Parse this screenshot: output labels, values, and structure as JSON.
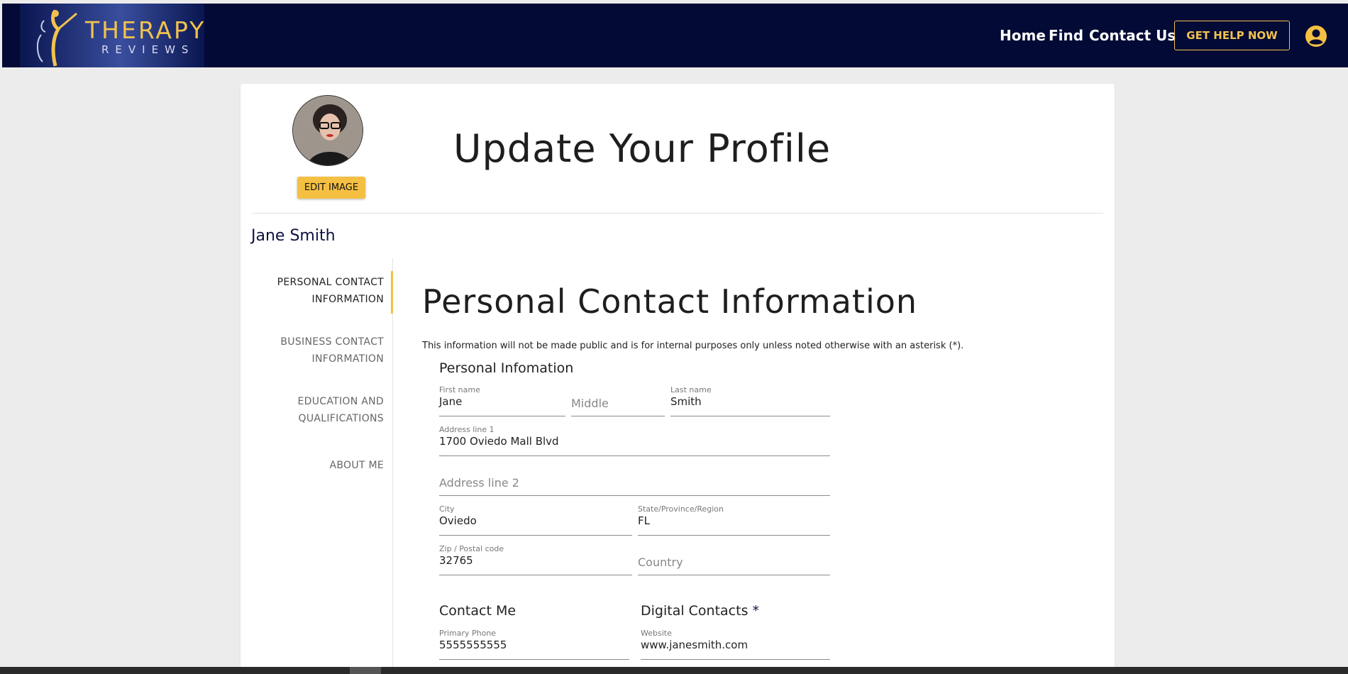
{
  "brand": {
    "name": "THERAPY",
    "sub": "REVIEWS"
  },
  "nav": {
    "home": "Home",
    "find": "Find",
    "contact": "Contact Us",
    "help": "GET HELP NOW"
  },
  "profile": {
    "title": "Update Your Profile",
    "edit_image": "EDIT IMAGE",
    "user_name": "Jane Smith"
  },
  "sidebar": {
    "items": [
      {
        "line1": "PERSONAL CONTACT",
        "line2": "INFORMATION"
      },
      {
        "line1": "BUSINESS CONTACT",
        "line2": "INFORMATION"
      },
      {
        "line1": "EDUCATION AND",
        "line2": "QUALIFICATIONS"
      },
      {
        "line1": "ABOUT ME",
        "line2": ""
      }
    ]
  },
  "section": {
    "title": "Personal Contact Information",
    "note": "This information will not be made public and is for internal purposes only unless noted otherwise with an asterisk (*)."
  },
  "personal": {
    "heading": "Personal Infomation",
    "first_label": "First name",
    "first_value": "Jane",
    "middle_placeholder": "Middle",
    "last_label": "Last name",
    "last_value": "Smith",
    "addr1_label": "Address line 1",
    "addr1_value": "1700 Oviedo Mall Blvd",
    "addr2_placeholder": "Address line 2",
    "city_label": "City",
    "city_value": "Oviedo",
    "state_label": "State/Province/Region",
    "state_value": "FL",
    "zip_label": "Zip / Postal code",
    "zip_value": "32765",
    "country_placeholder": "Country"
  },
  "contact": {
    "heading": "Contact Me",
    "phone_label": "Primary Phone",
    "phone_value": "5555555555"
  },
  "digital": {
    "heading": "Digital Contacts",
    "asterisk": "*",
    "website_label": "Website",
    "website_value": "www.janesmith.com"
  },
  "colors": {
    "header_bg": "#020a35",
    "accent": "#f5c042",
    "gold": "#f1c24d"
  }
}
